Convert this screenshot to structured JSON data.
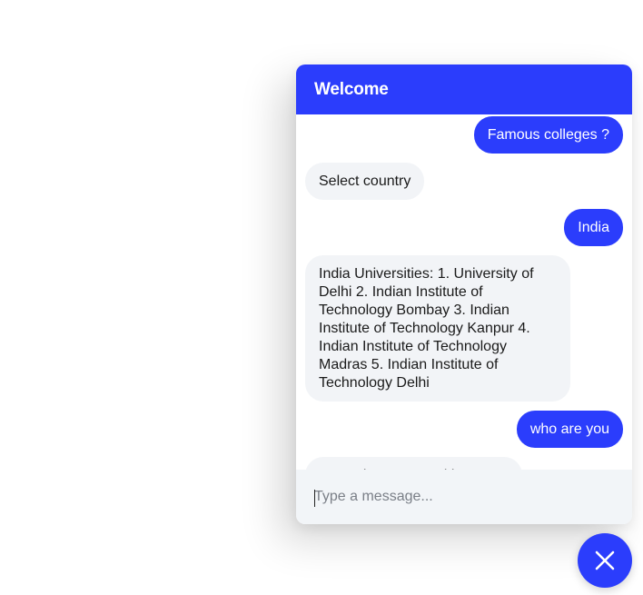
{
  "header": {
    "title": "Welcome"
  },
  "messages": [
    {
      "sender": "user",
      "text": "Famous colleges ?"
    },
    {
      "sender": "bot",
      "text": "Select country"
    },
    {
      "sender": "user",
      "text": "India"
    },
    {
      "sender": "bot",
      "text": "India Universities: 1. University of Delhi 2. Indian Institute of Technology Bombay 3. Indian Institute of Technology Kanpur 4. Indian Institute of Technology Madras 5. Indian Institute of Technology Delhi"
    },
    {
      "sender": "user",
      "text": "who are you"
    },
    {
      "sender": "bot",
      "text": "I am a bot, powered by Rasa."
    }
  ],
  "composer": {
    "placeholder": "Type a message...",
    "value": ""
  },
  "launcher": {
    "icon": "close-icon"
  },
  "colors": {
    "accent": "#2b3dfc",
    "bot_bubble": "#f2f4f7",
    "composer_bg": "#f2f5f8"
  }
}
